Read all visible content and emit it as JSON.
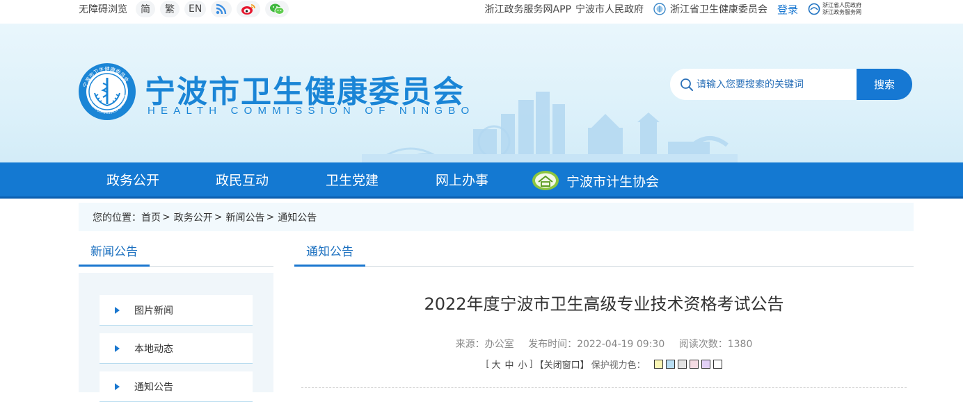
{
  "topbar": {
    "accessibility": "无障碍浏览",
    "lang_simplified": "简",
    "lang_traditional": "繁",
    "lang_english": "EN",
    "links": [
      "浙江政务服务网APP",
      "宁波市人民政府",
      "浙江省卫生健康委员会"
    ],
    "login": "登录",
    "gov_logo_line1": "浙江省人民政府",
    "gov_logo_line2": "浙江政务服务网"
  },
  "header": {
    "title": "宁波市卫生健康委员会",
    "subtitle": "HEALTH COMMISSION OF NINGBO",
    "seal_text": "宁波市卫生健康委员会",
    "seal_en": "HEALTH COMMISSION OF NINGBO"
  },
  "search": {
    "placeholder": "请输入您要搜索的关键词",
    "button": "搜索"
  },
  "nav": {
    "items": [
      "政务公开",
      "政民互动",
      "卫生党建",
      "网上办事"
    ],
    "association": "宁波市计生协会"
  },
  "breadcrumb": {
    "prefix": "您的位置：",
    "items": [
      "首页",
      "政务公开",
      "新闻公告",
      "通知公告"
    ],
    "separator": ">"
  },
  "sidebar": {
    "title": "新闻公告",
    "items": [
      "图片新闻",
      "本地动态",
      "通知公告"
    ]
  },
  "article": {
    "section": "通知公告",
    "title": "2022年度宁波市卫生高级专业技术资格考试公告",
    "source": "来源：办公室",
    "published": "发布时间：2022-04-19 09:30",
    "views": "阅读次数：1380",
    "tools_open": "[",
    "size_large": "大",
    "size_medium": "中",
    "size_small": "小",
    "tools_close": "]",
    "close_window": "【关闭窗口】",
    "eye_color_label": "保护视力色：",
    "eye_colors": [
      "#faf6b5",
      "#b8ddf2",
      "#e3e3e3",
      "#f5dbe3",
      "#e3d0f7",
      "#ffffff"
    ]
  },
  "colors": {
    "brand": "#1a85d6",
    "nav": "#1479d2",
    "accent_border": "#1a77cf"
  }
}
